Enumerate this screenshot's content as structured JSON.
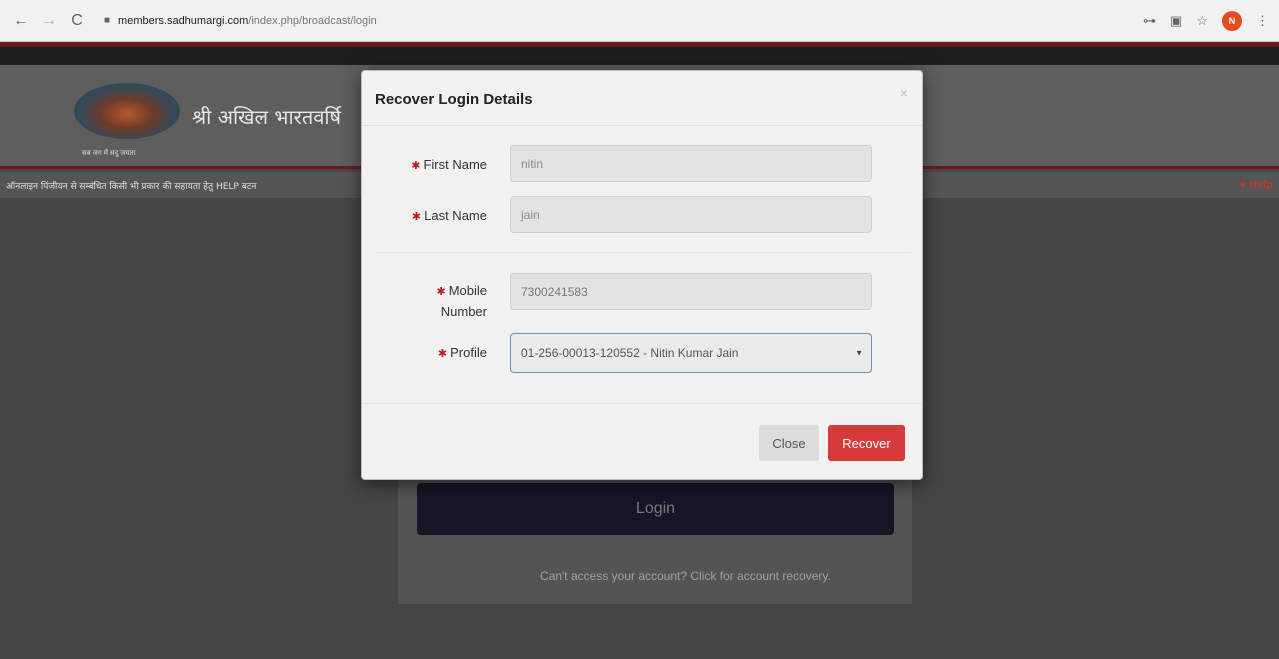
{
  "browser": {
    "back_glyph": "←",
    "forward_glyph": "→",
    "reload_glyph": "C",
    "lock_glyph": "■",
    "url_domain": "members.sadhumargi.com",
    "url_path": "/index.php/broadcast/login",
    "tool_icons": [
      "key-icon",
      "translate-icon",
      "star-icon"
    ],
    "key_glyph": "⊶",
    "translate_glyph": "▣",
    "star_glyph": "☆",
    "menu_glyph": "⋮",
    "profile_letter": "N"
  },
  "header": {
    "site_title": "श्री अखिल भारतवर्षि",
    "logo_caption": "सब जग में सदु जयता",
    "notice_text": "ऑनलाइन पिंजीयन से सम्बंधित किसी भी प्रकार की सहायता हेतु HELP बटन",
    "help_label": "Help",
    "help_glyph": "●"
  },
  "login": {
    "button_label": "Login",
    "recovery_link": "Can't access your account? Click for account recovery."
  },
  "modal": {
    "title": "Recover Login Details",
    "close_glyph": "×",
    "fields": {
      "first_name_label": "First Name",
      "first_name_value": "nitin",
      "last_name_label": "Last Name",
      "last_name_value": "jain",
      "mobile_label_line1": "Mobile",
      "mobile_label_line2": "Number",
      "mobile_value": "7300241583",
      "profile_label": "Profile",
      "profile_value": "01-256-00013-120552 -  Nitin Kumar  Jain"
    },
    "required_glyph": "✱",
    "close_button": "Close",
    "recover_button": "Recover"
  },
  "colors": {
    "accent_red": "#d63a3a",
    "required_star": "#b22222",
    "login_button": "#161628"
  }
}
